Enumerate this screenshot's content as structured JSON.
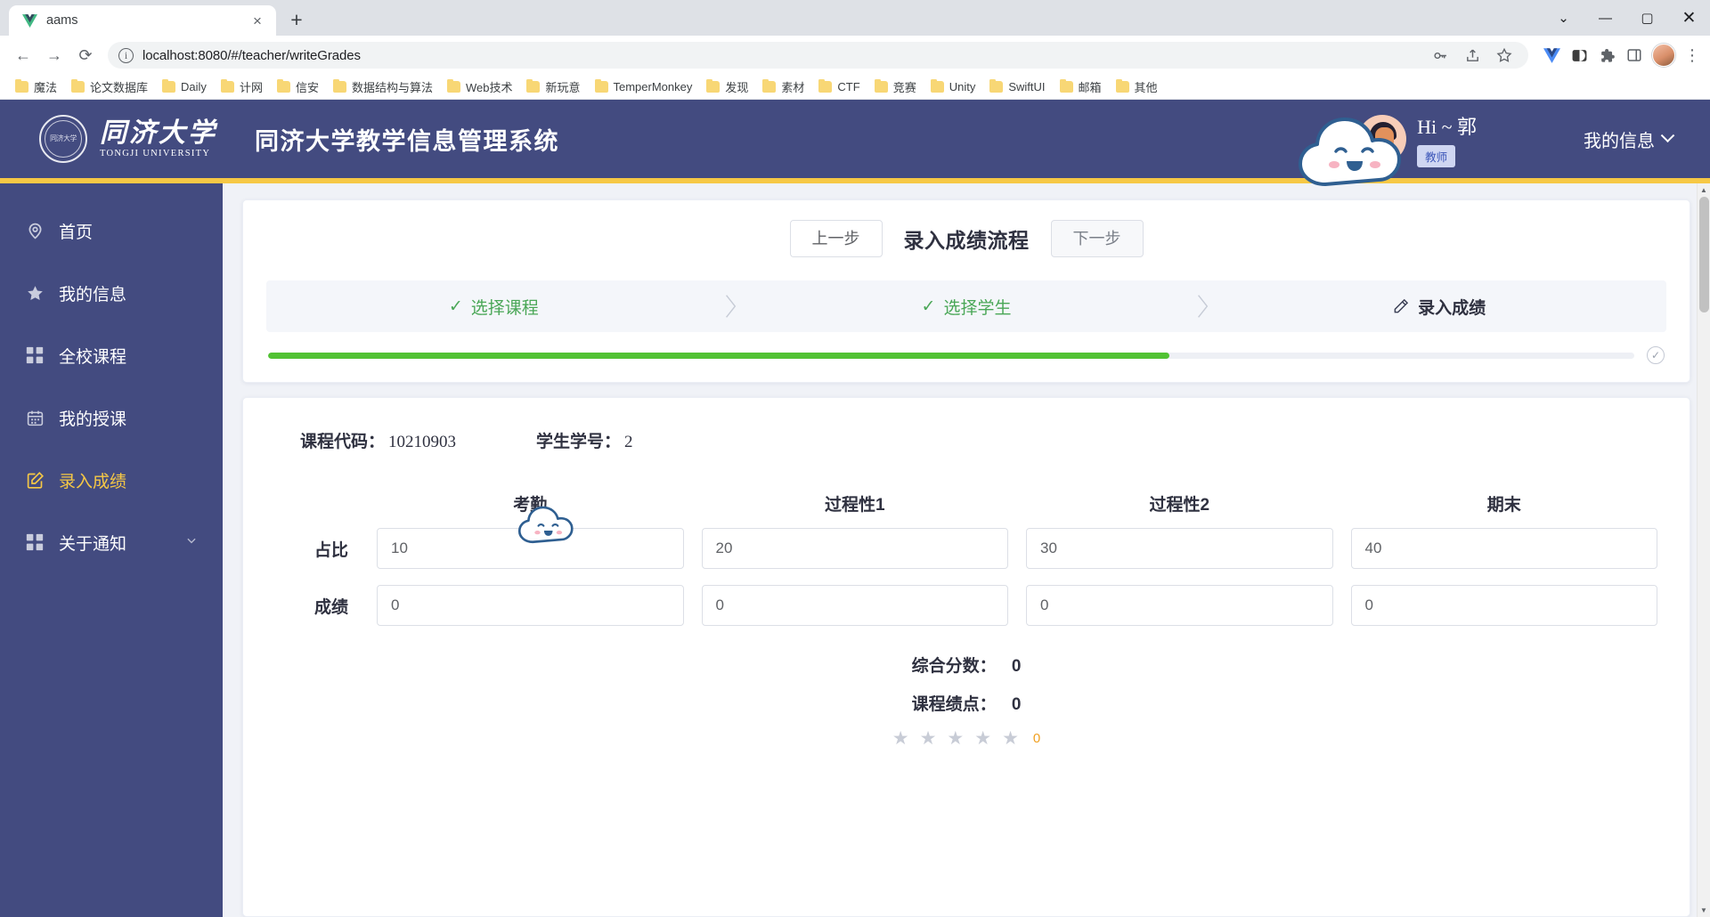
{
  "browser": {
    "tab": {
      "title": "aams",
      "favicon": "vue-logo-icon",
      "close": "×"
    },
    "new_tab": "+",
    "window_controls": {
      "minimize": "—",
      "maximize": "▢",
      "close": "✕",
      "more": "⌄"
    },
    "nav": {
      "back": "←",
      "forward": "→",
      "reload": "⟳"
    },
    "url": "localhost:8080/#/teacher/writeGrades",
    "omnibox_icons": [
      "key-icon",
      "share-icon",
      "bookmark-star-icon"
    ],
    "extension_icons": [
      "vimium-v-icon",
      "dark-reader-icon",
      "puzzle-extensions-icon",
      "sidepanel-icon",
      "profile-avatar-icon",
      "kebab-menu-icon"
    ],
    "bookmarks": [
      "魔法",
      "论文数据库",
      "Daily",
      "计网",
      "信安",
      "数据结构与算法",
      "Web技术",
      "新玩意",
      "TemperMonkey",
      "发现",
      "素材",
      "CTF",
      "竞赛",
      "Unity",
      "SwiftUI",
      "邮箱",
      "其他"
    ]
  },
  "app": {
    "header": {
      "logo_cn": "同济大学",
      "logo_en": "TONGJI UNIVERSITY",
      "seal_text": "同济大学",
      "system_title": "同济大学教学信息管理系统",
      "greeting": "Hi ~ 郭",
      "role_badge": "教师",
      "my_info": "我的信息",
      "accent_bar_color": "#f6c845",
      "header_bg": "#434b80"
    },
    "sidebar": {
      "items": [
        {
          "label": "首页",
          "icon": "location-pin-icon",
          "active": false,
          "expandable": false
        },
        {
          "label": "我的信息",
          "icon": "star-icon",
          "active": false,
          "expandable": false
        },
        {
          "label": "全校课程",
          "icon": "grid-icon",
          "active": false,
          "expandable": false
        },
        {
          "label": "我的授课",
          "icon": "calendar-icon",
          "active": false,
          "expandable": false
        },
        {
          "label": "录入成绩",
          "icon": "edit-square-icon",
          "active": true,
          "expandable": false
        },
        {
          "label": "关于通知",
          "icon": "grid-icon",
          "active": false,
          "expandable": true
        }
      ],
      "active_color": "#f6c845"
    },
    "stepper_card": {
      "prev_button": "上一步",
      "next_button": "下一步",
      "title": "录入成绩流程",
      "steps": [
        {
          "label": "选择课程",
          "state": "done",
          "icon": "check-icon"
        },
        {
          "label": "选择学生",
          "state": "done",
          "icon": "check-icon"
        },
        {
          "label": "录入成绩",
          "state": "current",
          "icon": "pencil-icon"
        }
      ],
      "separator_icon": "chevron-right-icon",
      "progress_percent": 66,
      "progress_color": "#51c233",
      "end_icon": "circle-check-icon"
    },
    "form_card": {
      "course_code_label": "课程代码：",
      "course_code_value": "10210903",
      "student_id_label": "学生学号：",
      "student_id_value": "2",
      "columns": [
        "考勤",
        "过程性1",
        "过程性2",
        "期末"
      ],
      "weight_row_label": "占比",
      "weight_values": [
        "10",
        "20",
        "30",
        "40"
      ],
      "score_row_label": "成绩",
      "score_values": [
        "0",
        "0",
        "0",
        "0"
      ],
      "total_label": "综合分数：",
      "total_value": "0",
      "gpa_label": "课程绩点：",
      "gpa_value": "0",
      "rating_stars": 5,
      "rating_value": "0",
      "rating_color": "#f0a020"
    },
    "mascots": [
      "cloud-mascot-large",
      "cloud-mascot-small"
    ]
  }
}
